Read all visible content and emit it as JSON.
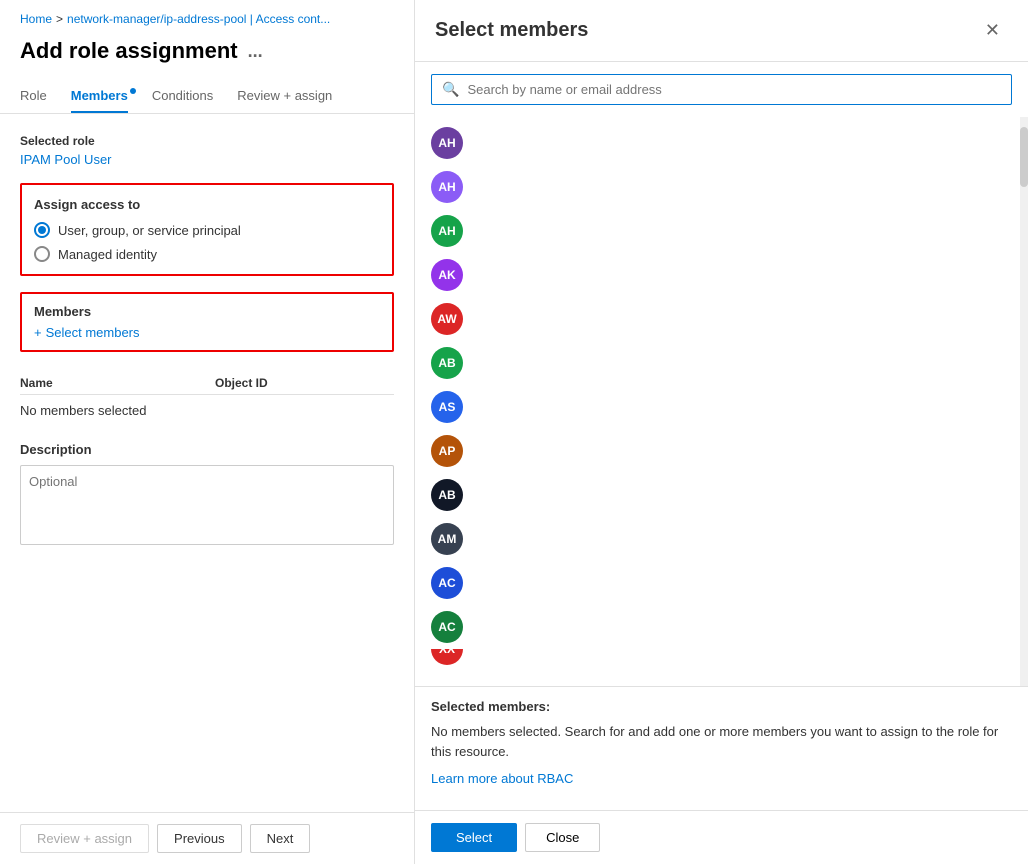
{
  "breadcrumb": {
    "home": "Home",
    "separator": ">",
    "resource": "network-manager/ip-address-pool | Access cont..."
  },
  "page": {
    "title": "Add role assignment",
    "ellipsis": "..."
  },
  "tabs": [
    {
      "id": "role",
      "label": "Role",
      "active": false,
      "dot": false
    },
    {
      "id": "members",
      "label": "Members",
      "active": true,
      "dot": true
    },
    {
      "id": "conditions",
      "label": "Conditions",
      "active": false,
      "dot": false
    },
    {
      "id": "review",
      "label": "Review + assign",
      "active": false,
      "dot": false
    }
  ],
  "selected_role": {
    "label": "Selected role",
    "value": "IPAM Pool User"
  },
  "assign_access": {
    "title": "Assign access to",
    "options": [
      {
        "id": "ugs",
        "label": "User, group, or service principal",
        "checked": true
      },
      {
        "id": "mi",
        "label": "Managed identity",
        "checked": false
      }
    ]
  },
  "members": {
    "title": "Members",
    "select_label": "+ Select members"
  },
  "table": {
    "columns": [
      "Name",
      "Object ID"
    ],
    "no_members_text": "No members selected"
  },
  "description": {
    "label": "Description",
    "placeholder": "Optional"
  },
  "bottom_bar": {
    "review_assign": "Review + assign",
    "previous": "Previous",
    "next": "Next"
  },
  "modal": {
    "title": "Select members",
    "search_placeholder": "Search by name or email address",
    "close_label": "✕",
    "members": [
      {
        "initials": "AH",
        "color": "#6b3fa0"
      },
      {
        "initials": "AH",
        "color": "#8b5cf6"
      },
      {
        "initials": "AH",
        "color": "#16a34a"
      },
      {
        "initials": "AK",
        "color": "#9333ea"
      },
      {
        "initials": "AW",
        "color": "#dc2626"
      },
      {
        "initials": "AB",
        "color": "#16a34a"
      },
      {
        "initials": "AS",
        "color": "#2563eb"
      },
      {
        "initials": "AP",
        "color": "#b45309"
      },
      {
        "initials": "AB",
        "color": "#111827"
      },
      {
        "initials": "AM",
        "color": "#374151"
      },
      {
        "initials": "AC",
        "color": "#1d4ed8"
      },
      {
        "initials": "AC",
        "color": "#15803d"
      },
      {
        "initials": "XX",
        "color": "#dc2626"
      }
    ],
    "selected_title": "Selected members:",
    "no_selected_msg": "No members selected. Search for and add one or more members you want to assign to the role for this resource.",
    "learn_link": "Learn more about RBAC",
    "select_btn": "Select",
    "close_btn": "Close"
  }
}
